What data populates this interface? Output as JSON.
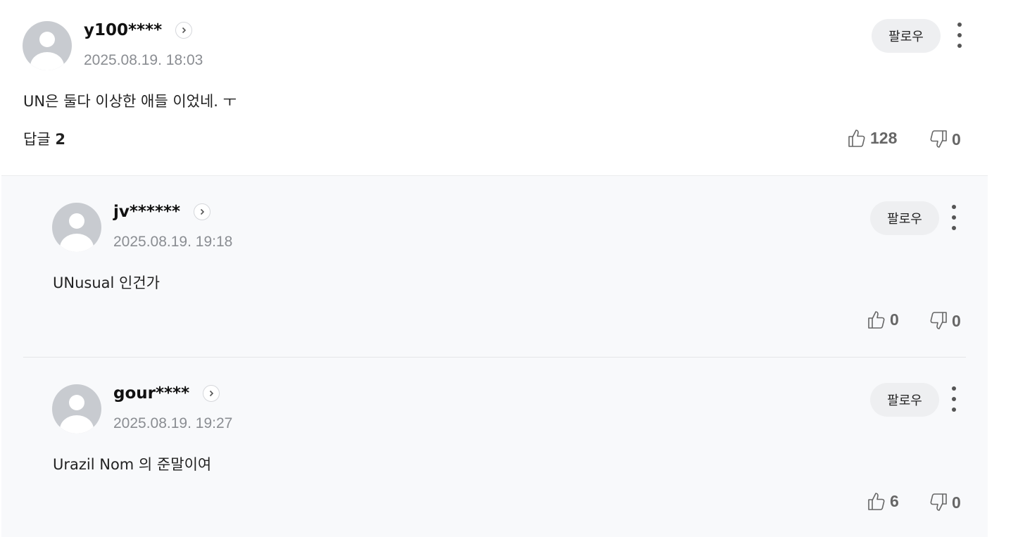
{
  "comment": {
    "username": "y100****",
    "date": "2025.08.19. 18:03",
    "text": "UN은 둘다 이상한 애들 이었네. ㅜ",
    "follow_label": "팔로우",
    "replies_label": "답글",
    "replies_count": "2",
    "likes": "128",
    "dislikes": "0"
  },
  "replies": [
    {
      "username": "jv******",
      "date": "2025.08.19. 19:18",
      "text": "UNusual 인건가",
      "follow_label": "팔로우",
      "likes": "0",
      "dislikes": "0"
    },
    {
      "username": "gour****",
      "date": "2025.08.19. 19:27",
      "text": "Urazil Nom 의 준말이여",
      "follow_label": "팔로우",
      "likes": "6",
      "dislikes": "0"
    }
  ],
  "icons": {
    "profile": "chevron-right-icon",
    "like": "thumbs-up-icon",
    "dislike": "thumbs-down-icon",
    "more": "more-vertical-icon"
  }
}
